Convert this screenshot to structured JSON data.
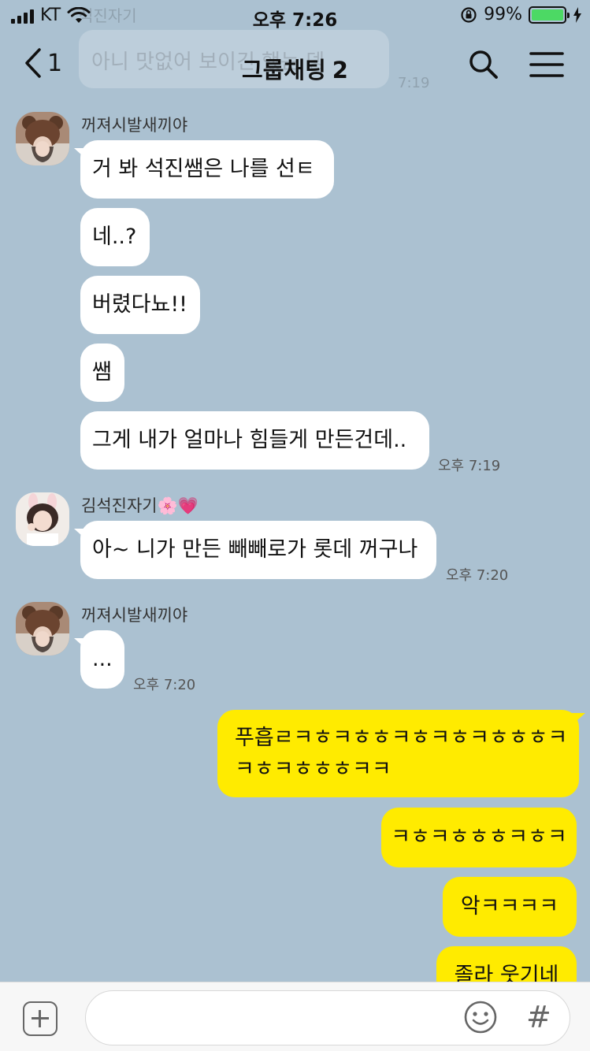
{
  "status_bar": {
    "carrier": "KT",
    "time": "오후 7:26",
    "battery_percent": "99%",
    "battery_level": 0.99,
    "battery_color": "#4cd964"
  },
  "header": {
    "back_count": "1",
    "title": "그룹채팅",
    "member_count": "2",
    "icons": [
      "chevron-left-icon",
      "search-icon",
      "menu-icon"
    ]
  },
  "ghost": {
    "sender": "석진자기",
    "text": "아니 맛없어 보이긴 했는 뎅",
    "time": "7:19"
  },
  "colors": {
    "background": "#abc1d1",
    "my_bubble": "#ffeb00",
    "their_bubble": "#ffffff"
  },
  "messages": [
    {
      "sender": "꺼져시발새끼야",
      "bubbles": [
        "거 봐 석진쌤은 나를 선ㅌ",
        "네..?",
        "버렸다뇨!!",
        "쌤",
        "그게 내가 얼마나 힘들게 만든건데.."
      ],
      "time": "오후 7:19"
    },
    {
      "sender": "김석진자기🌸💗",
      "bubbles": [
        "아~ 니가 만든 빼빼로가 롯데 꺼구나"
      ],
      "time": "오후 7:20"
    },
    {
      "sender": "꺼져시발새끼야",
      "bubbles": [
        "..."
      ],
      "time": "오후 7:20"
    },
    {
      "sender": "me",
      "bubbles": [
        [
          "푸흡ㄹㅋㅎㅋㅎㅎㅋㅎㅋㅎㅋㅎㅎㅎㅋ",
          "ㅋㅎㅋㅎㅎㅎㅋㅋ"
        ],
        "ㅋㅎㅋㅎㅎㅎㅋㅎㅋ",
        "악ㅋㅋㅋㅋ",
        "졸라 웃기네"
      ]
    }
  ],
  "input": {
    "placeholder": "",
    "value": "",
    "icons": [
      "plus-icon",
      "emoji-icon",
      "hash-icon"
    ],
    "hash_label": "#"
  }
}
